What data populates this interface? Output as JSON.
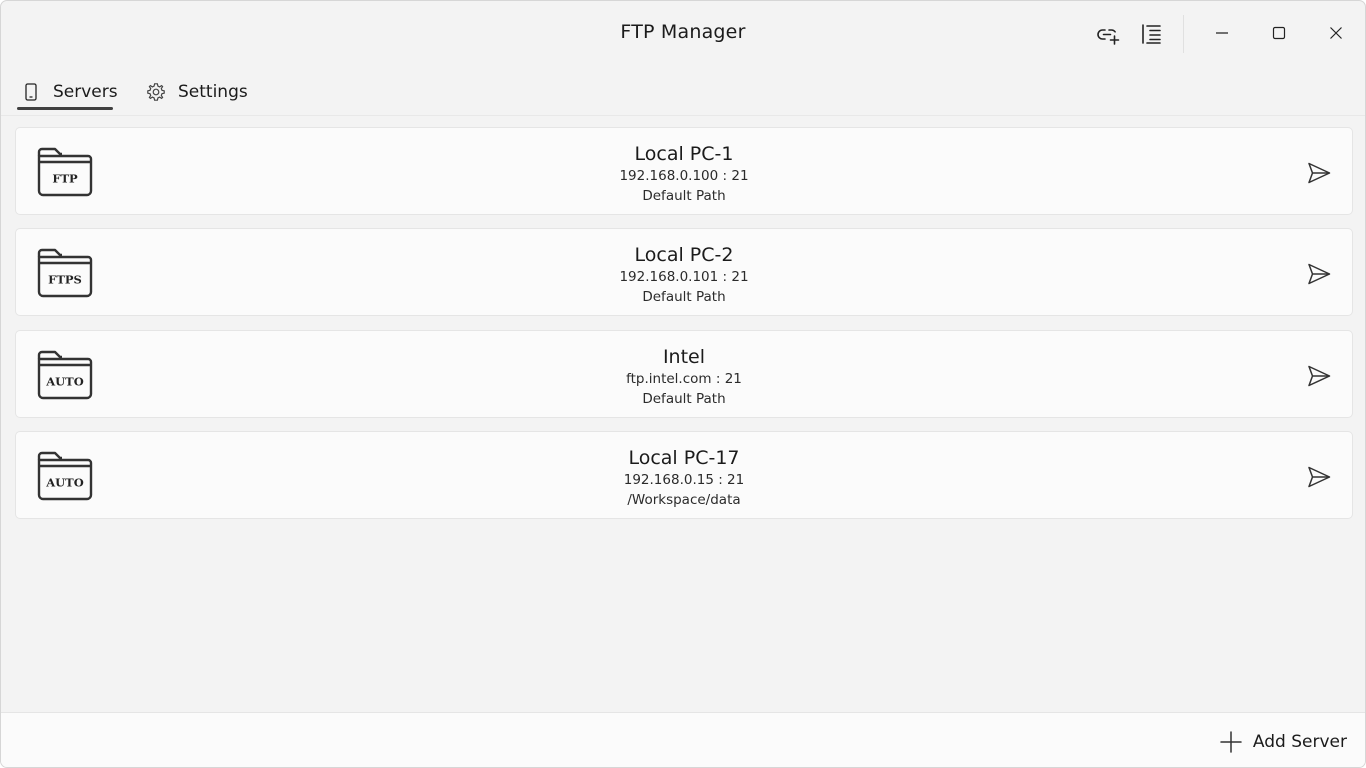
{
  "window": {
    "title": "FTP Manager"
  },
  "toolbar": {
    "connect_icon": "link-add-icon",
    "list_icon": "list-icon"
  },
  "tabs": [
    {
      "label": "Servers",
      "icon": "phone-icon",
      "selected": true
    },
    {
      "label": "Settings",
      "icon": "gear-icon",
      "selected": false
    }
  ],
  "servers": [
    {
      "name": "Local PC-1",
      "address": "192.168.0.100 : 21",
      "path": "Default Path",
      "protocol": "FTP"
    },
    {
      "name": "Local PC-2",
      "address": "192.168.0.101 : 21",
      "path": "Default Path",
      "protocol": "FTPS"
    },
    {
      "name": "Intel",
      "address": "ftp.intel.com : 21",
      "path": "Default Path",
      "protocol": "AUTO"
    },
    {
      "name": "Local PC-17",
      "address": "192.168.0.15 : 21",
      "path": "/Workspace/data",
      "protocol": "AUTO"
    }
  ],
  "footer": {
    "add_label": "Add Server"
  },
  "colors": {
    "accent": "#404040",
    "background": "#f3f3f3",
    "card": "#fbfbfb"
  }
}
